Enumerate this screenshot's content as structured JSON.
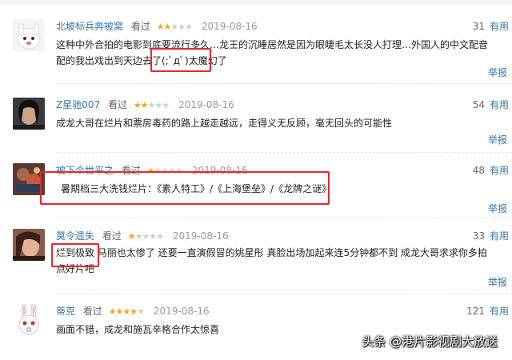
{
  "useful_label": "有用",
  "report_label": "举报",
  "reviews": [
    {
      "user": "北坡标兵奔被窝",
      "status": "看过",
      "rating": 2,
      "date": "2019-08-16",
      "votes": "31",
      "text": "这种中外合拍的电影到底要流行多久…龙王的沉睡居然是因为眼睫毛太长没人打理…外国人的中文配音配的我出戏出到天边去了(;ﾟдﾟ)太魔幻了"
    },
    {
      "user": "Z星驰007",
      "status": "看过",
      "rating": 2,
      "date": "2019-08-16",
      "votes": "54",
      "text": "成龙大哥在烂片和票房毒药的路上越走越远，走得义无反顾，毫无回头的可能性"
    },
    {
      "user": "被下个世平之",
      "status": "看过",
      "rating": 1,
      "date": "2019-08-16",
      "votes": "48",
      "text": "暑期档三大洗钱烂片：《素人特工》/《上海堡垒》/《龙牌之谜》"
    },
    {
      "user": "莫令遗失",
      "status": "看过",
      "rating": 1,
      "date": "2019-08-16",
      "votes": "33",
      "text": "烂到极致 马丽也太惨了 还要一直演假冒的姚星彤 真脸出场加起来连5分钟都不到 成龙大哥求求你多拍点好片吧"
    },
    {
      "user": "蒂克",
      "status": "看过",
      "rating": 4,
      "date": "2019-08-16",
      "votes": "121",
      "text": "画面不错，成龙和施瓦辛格合作太惊喜"
    }
  ],
  "watermark": "头条 @港片影视剧大放送",
  "colors": {
    "link": "#3377aa",
    "star_on": "#f5a623",
    "star_off": "#cfcfcf",
    "highlight": "#e8262a"
  }
}
